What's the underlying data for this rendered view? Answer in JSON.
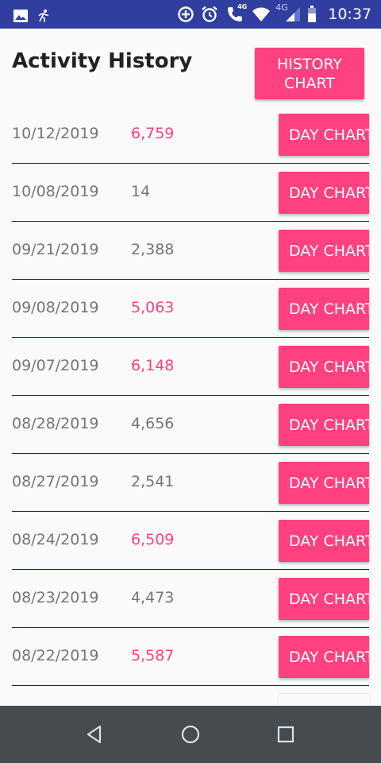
{
  "status_bar": {
    "time": "10:37",
    "network_label": "4G",
    "call_label": "4G",
    "icons": [
      "image-icon",
      "activity-runner-icon",
      "data-saver-icon",
      "alarm-icon",
      "wifi-calling-icon",
      "wifi-icon",
      "cell-signal-icon",
      "battery-icon"
    ]
  },
  "header": {
    "title": "Activity History",
    "history_chart_label": "HISTORY\nCHART"
  },
  "colors": {
    "status_bar": "#303f9f",
    "accent": "#ff4081",
    "divider": "#1a237e",
    "text_secondary": "#757575",
    "nav_bar": "#464b50"
  },
  "day_chart_label": "DAY CHART",
  "entries": [
    {
      "date": "10/12/2019",
      "steps": "6,759",
      "highlight": true
    },
    {
      "date": "10/08/2019",
      "steps": "14",
      "highlight": false
    },
    {
      "date": "09/21/2019",
      "steps": "2,388",
      "highlight": false
    },
    {
      "date": "09/08/2019",
      "steps": "5,063",
      "highlight": true
    },
    {
      "date": "09/07/2019",
      "steps": "6,148",
      "highlight": true
    },
    {
      "date": "08/28/2019",
      "steps": "4,656",
      "highlight": false
    },
    {
      "date": "08/27/2019",
      "steps": "2,541",
      "highlight": false
    },
    {
      "date": "08/24/2019",
      "steps": "6,509",
      "highlight": true
    },
    {
      "date": "08/23/2019",
      "steps": "4,473",
      "highlight": false
    },
    {
      "date": "08/22/2019",
      "steps": "5,587",
      "highlight": true
    }
  ],
  "nav_bar": {
    "icons": [
      "back-icon",
      "home-icon",
      "recents-icon"
    ]
  }
}
